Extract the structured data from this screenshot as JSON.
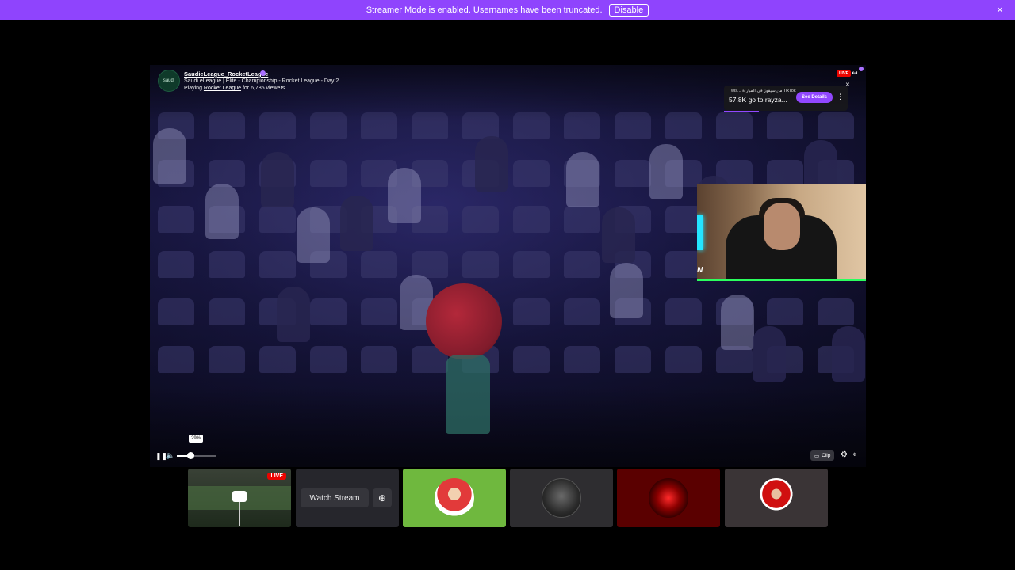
{
  "banner": {
    "text": "Streamer Mode is enabled. Usernames have been truncated.",
    "disable_label": "Disable",
    "close_icon": "×",
    "color": "#8f44fd"
  },
  "channel": {
    "name": "SaudieLeague_RocketLeague",
    "title": "Saudi eLeague | Elite - Championship - Rocket League - Day 2",
    "playing_prefix": "Playing",
    "game": "Rocket League",
    "viewers_text": "for 6,785 viewers",
    "avatar_text": "saudi"
  },
  "player": {
    "live_label": "LIVE",
    "volume_percent": 29,
    "volume_tooltip": "29%",
    "clip_label": "Clip"
  },
  "ad": {
    "line1": "Twis... من سيفوز في المباراة TikTok",
    "line2": "57.8K go to rayza...",
    "button_label": "See Details"
  },
  "webcam": {
    "logo_text": "N"
  },
  "thumbnails": {
    "first_live_label": "LIVE",
    "watch_stream_label": "Watch Stream"
  },
  "icons": {
    "pause": "pause-icon",
    "volume": "volume-icon",
    "settings": "gear-icon",
    "theatre": "theatre-mode-icon",
    "close": "close-icon"
  }
}
